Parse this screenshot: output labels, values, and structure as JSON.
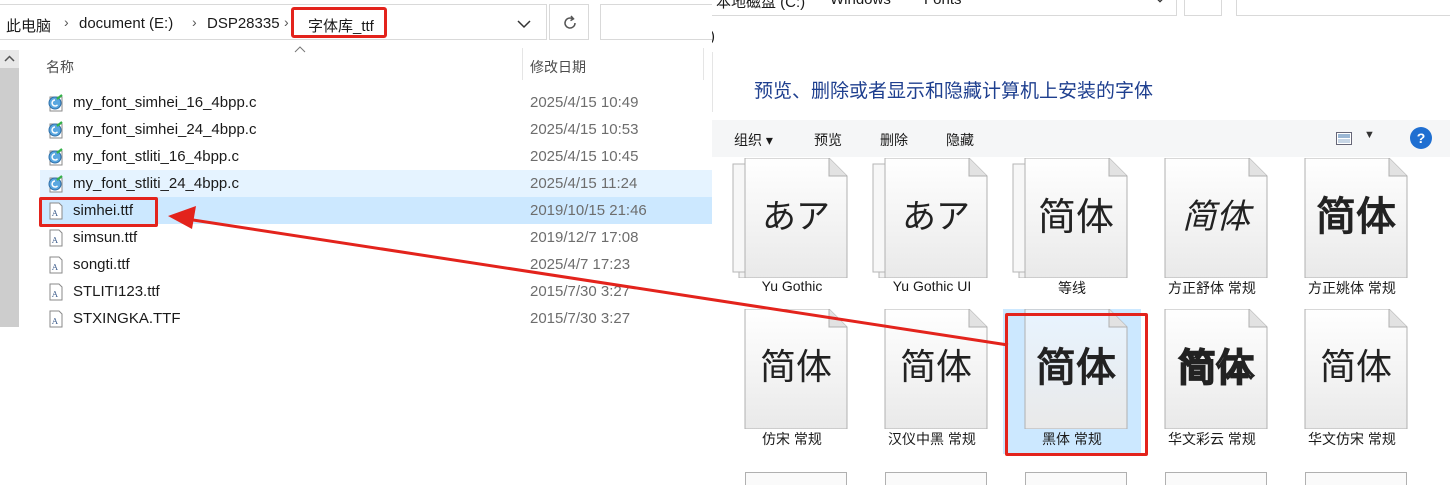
{
  "explorer": {
    "breadcrumb": [
      "此电脑",
      "document (E:)",
      "DSP28335",
      "字体库_ttf"
    ],
    "columns": {
      "name": "名称",
      "date": "修改日期"
    },
    "files": [
      {
        "name": "my_font_simhei_16_4bpp.c",
        "date": "2025/4/15 10:49",
        "icon": "c-source-file-icon"
      },
      {
        "name": "my_font_simhei_24_4bpp.c",
        "date": "2025/4/15 10:53",
        "icon": "c-source-file-icon"
      },
      {
        "name": "my_font_stliti_16_4bpp.c",
        "date": "2025/4/15 10:45",
        "icon": "c-source-file-icon"
      },
      {
        "name": "my_font_stliti_24_4bpp.c",
        "date": "2025/4/15 11:24",
        "icon": "c-source-file-icon"
      },
      {
        "name": "simhei.ttf",
        "date": "2019/10/15 21:46",
        "icon": "font-file-icon"
      },
      {
        "name": "simsun.ttf",
        "date": "2019/12/7 17:08",
        "icon": "font-file-icon"
      },
      {
        "name": "songti.ttf",
        "date": "2025/4/7 17:23",
        "icon": "font-file-icon"
      },
      {
        "name": "STLITI123.ttf",
        "date": "2015/7/30 3:27",
        "icon": "font-file-icon"
      },
      {
        "name": "STXINGKA.TTF",
        "date": "2015/7/30 3:27",
        "icon": "font-file-icon"
      }
    ]
  },
  "fonts_panel": {
    "address": [
      "本地磁盘 (C:)",
      "Windows",
      "Fonts"
    ],
    "paren": ")",
    "title": "预览、删除或者显示和隐藏计算机上安装的字体",
    "toolbar": {
      "organize": "组织 ▾",
      "preview": "预览",
      "delete": "删除",
      "hide": "隐藏",
      "help": "?"
    },
    "tiles": [
      {
        "label": "Yu Gothic",
        "glyph": "あア",
        "stacked": true
      },
      {
        "label": "Yu Gothic UI",
        "glyph": "あア",
        "stacked": true
      },
      {
        "label": "等线",
        "glyph": "简体",
        "stacked": true
      },
      {
        "label": "方正舒体 常规",
        "glyph": "简体",
        "stacked": false
      },
      {
        "label": "方正姚体 常规",
        "glyph": "简体",
        "stacked": false
      },
      {
        "label": "仿宋 常规",
        "glyph": "简体",
        "stacked": false
      },
      {
        "label": "汉仪中黑 常规",
        "glyph": "简体",
        "stacked": false
      },
      {
        "label": "黑体 常规",
        "glyph": "简体",
        "stacked": false,
        "selected": true
      },
      {
        "label": "华文彩云 常规",
        "glyph": "简体",
        "stacked": false
      },
      {
        "label": "华文仿宋 常规",
        "glyph": "简体",
        "stacked": false
      }
    ]
  },
  "colors": {
    "highlight": "#e3231c",
    "selection": "#cce8ff",
    "hover": "#e5f3ff",
    "title": "#1e3f8f"
  }
}
